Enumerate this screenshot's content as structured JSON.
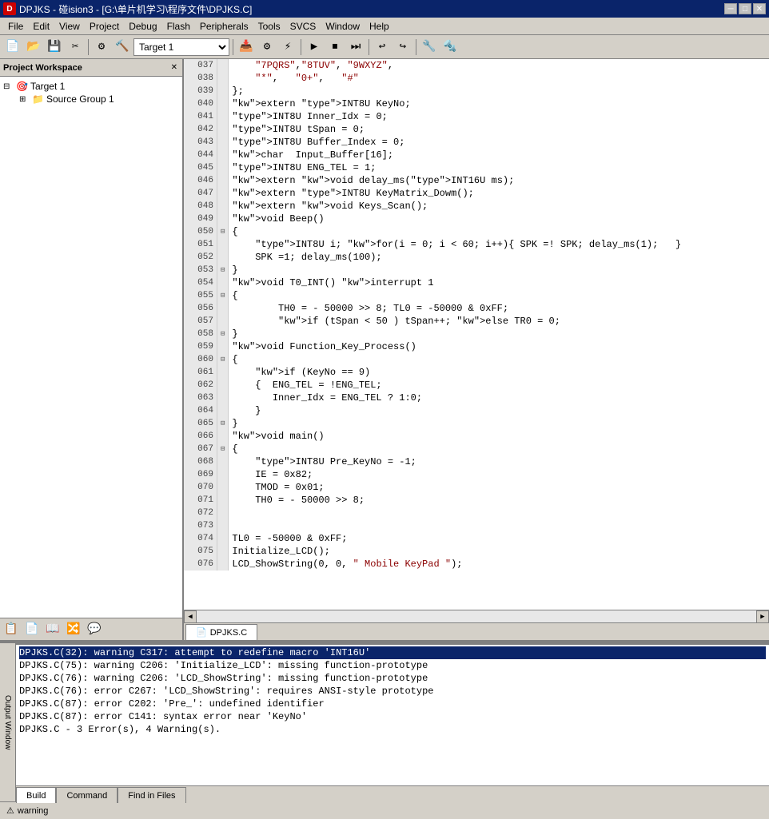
{
  "titlebar": {
    "icon": "D",
    "text": "DPJKS - 碰ision3 - [G:\\单片机学习\\程序文件\\DPJKS.C]",
    "minimize": "─",
    "maximize": "□",
    "close": "✕"
  },
  "menubar": {
    "items": [
      "File",
      "Edit",
      "View",
      "Project",
      "Debug",
      "Flash",
      "Peripherals",
      "Tools",
      "SVCS",
      "Window",
      "Help"
    ]
  },
  "toolbar": {
    "target_label": "Target 1"
  },
  "project_panel": {
    "title": "Project Workspace",
    "close_btn": "✕",
    "tree": {
      "root": "Target 1",
      "child": "Source Group 1"
    }
  },
  "code_lines": [
    {
      "num": "037",
      "collapse": false,
      "content": "    \"7PQRS\",\"8TUV\", \"9WXYZ\","
    },
    {
      "num": "038",
      "collapse": false,
      "content": "    \"*\",   \"0+\",   \"#\""
    },
    {
      "num": "039",
      "collapse": false,
      "content": "};"
    },
    {
      "num": "040",
      "collapse": false,
      "content": "extern INT8U KeyNo;"
    },
    {
      "num": "041",
      "collapse": false,
      "content": "INT8U Inner_Idx = 0;"
    },
    {
      "num": "042",
      "collapse": false,
      "content": "INT8U tSpan = 0;"
    },
    {
      "num": "043",
      "collapse": false,
      "content": "INT8U Buffer_Index = 0;"
    },
    {
      "num": "044",
      "collapse": false,
      "content": "char  Input_Buffer[16];"
    },
    {
      "num": "045",
      "collapse": false,
      "content": "INT8U ENG_TEL = 1;"
    },
    {
      "num": "046",
      "collapse": false,
      "content": "extern void delay_ms(INT16U ms);"
    },
    {
      "num": "047",
      "collapse": false,
      "content": "extern INT8U KeyMatrix_Dowm();"
    },
    {
      "num": "048",
      "collapse": false,
      "content": "extern void Keys_Scan();"
    },
    {
      "num": "049",
      "collapse": false,
      "content": "void Beep()"
    },
    {
      "num": "050",
      "collapse": true,
      "content": "{"
    },
    {
      "num": "051",
      "collapse": false,
      "content": "    INT8U i; for(i = 0; i < 60; i++){ SPK =! SPK; delay_ms(1);   }"
    },
    {
      "num": "052",
      "collapse": false,
      "content": "    SPK =1; delay_ms(100);"
    },
    {
      "num": "053",
      "collapse": false,
      "content": "-}"
    },
    {
      "num": "054",
      "collapse": false,
      "content": "void T0_INT() interrupt 1"
    },
    {
      "num": "055",
      "collapse": true,
      "content": "{"
    },
    {
      "num": "056",
      "collapse": false,
      "content": "        TH0 = - 50000 >> 8; TL0 = -50000 & 0xFF;"
    },
    {
      "num": "057",
      "collapse": false,
      "content": "        if (tSpan < 50 ) tSpan++; else TR0 = 0;"
    },
    {
      "num": "058",
      "collapse": false,
      "content": "-}"
    },
    {
      "num": "059",
      "collapse": false,
      "content": "void Function_Key_Process()"
    },
    {
      "num": "060",
      "collapse": true,
      "content": "{"
    },
    {
      "num": "061",
      "collapse": false,
      "content": "    if (KeyNo == 9)"
    },
    {
      "num": "062",
      "collapse": false,
      "content": "    {  ENG_TEL = !ENG_TEL;"
    },
    {
      "num": "063",
      "collapse": false,
      "content": "       Inner_Idx = ENG_TEL ? 1:0;"
    },
    {
      "num": "064",
      "collapse": false,
      "content": "    }"
    },
    {
      "num": "065",
      "collapse": false,
      "content": "-}"
    },
    {
      "num": "066",
      "collapse": false,
      "content": "void main()"
    },
    {
      "num": "067",
      "collapse": true,
      "content": "{"
    },
    {
      "num": "068",
      "collapse": false,
      "content": "    INT8U Pre_KeyNo = -1;"
    },
    {
      "num": "069",
      "collapse": false,
      "content": "    IE = 0x82;"
    },
    {
      "num": "070",
      "collapse": false,
      "content": "    TMOD = 0x01;"
    },
    {
      "num": "071",
      "collapse": false,
      "content": "    TH0 = - 50000 >> 8;"
    },
    {
      "num": "072",
      "collapse": false,
      "content": ""
    },
    {
      "num": "073",
      "collapse": false,
      "content": ""
    },
    {
      "num": "074",
      "collapse": false,
      "content": "TL0 = -50000 & 0xFF;"
    },
    {
      "num": "075",
      "collapse": false,
      "content": "Initialize_LCD();"
    },
    {
      "num": "076",
      "collapse": false,
      "content": "LCD_ShowString(0, 0, \" Mobile KeyPad \");"
    }
  ],
  "editor_tab": {
    "filename": "DPJKS.C",
    "icon": "📄"
  },
  "output": {
    "side_label": "Output Window",
    "lines": [
      {
        "text": "DPJKS.C(32): warning C317: attempt to redefine macro 'INT16U'",
        "selected": true
      },
      {
        "text": "DPJKS.C(75): warning C206: 'Initialize_LCD': missing function-prototype",
        "selected": false
      },
      {
        "text": "DPJKS.C(76): warning C206: 'LCD_ShowString': missing function-prototype",
        "selected": false
      },
      {
        "text": "DPJKS.C(76): error C267: 'LCD_ShowString': requires ANSI-style prototype",
        "selected": false
      },
      {
        "text": "DPJKS.C(87): error C202: 'Pre_': undefined identifier",
        "selected": false
      },
      {
        "text": "DPJKS.C(87): error C141: syntax error near 'KeyNo'",
        "selected": false
      },
      {
        "text": "DPJKS.C - 3 Error(s), 4 Warning(s).",
        "selected": false
      }
    ],
    "tabs": [
      "Build",
      "Command",
      "Find in Files"
    ],
    "active_tab": "Build"
  },
  "status": {
    "warning_label": "warning",
    "items": []
  },
  "colors": {
    "titlebar_bg": "#0a246a",
    "selected_bg": "#0a246a",
    "panel_bg": "#d4d0c8",
    "code_bg": "#ffffff"
  }
}
